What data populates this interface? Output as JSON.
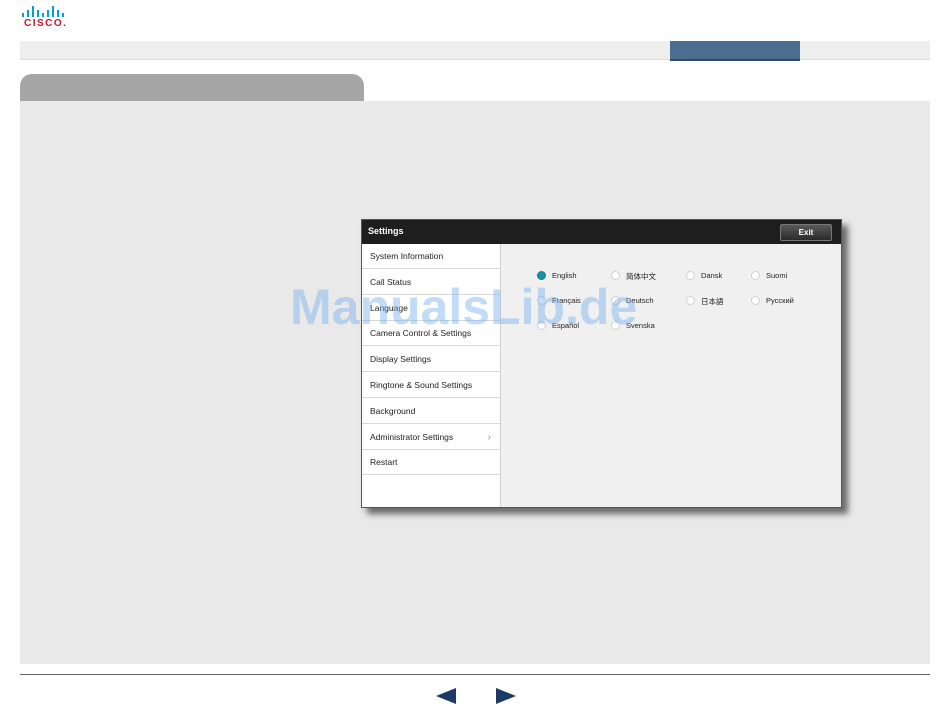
{
  "logo": {
    "text": "CISCO.",
    "bar_color": "#049fd9"
  },
  "topnav": {
    "active_color": "#4c6c90"
  },
  "settings_window": {
    "title": "Settings",
    "exit_label": "Exit",
    "menu": [
      {
        "label": "System Information"
      },
      {
        "label": "Call Status"
      },
      {
        "label": "Language"
      },
      {
        "label": "Camera Control & Settings"
      },
      {
        "label": "Display Settings"
      },
      {
        "label": "Ringtone & Sound Settings"
      },
      {
        "label": "Background"
      },
      {
        "label": "Administrator Settings",
        "chevron": "chevron-right-icon"
      },
      {
        "label": "Restart"
      }
    ],
    "languages": [
      {
        "label": "English",
        "selected": true
      },
      {
        "label": "简体中文",
        "selected": false
      },
      {
        "label": "Dansk",
        "selected": false
      },
      {
        "label": "Suomi",
        "selected": false
      },
      {
        "label": "Français",
        "selected": false
      },
      {
        "label": "Deutsch",
        "selected": false
      },
      {
        "label": "日本語",
        "selected": false
      },
      {
        "label": "Русский",
        "selected": false
      },
      {
        "label": "Español",
        "selected": false
      },
      {
        "label": "Svenska",
        "selected": false
      }
    ],
    "selected_color": "#1e90a8"
  },
  "watermark": {
    "text": "ManualsLib.de"
  },
  "footer": {
    "prev_icon": "arrow-left-icon",
    "next_icon": "arrow-right-icon",
    "arrow_color": "#1b3b66"
  }
}
